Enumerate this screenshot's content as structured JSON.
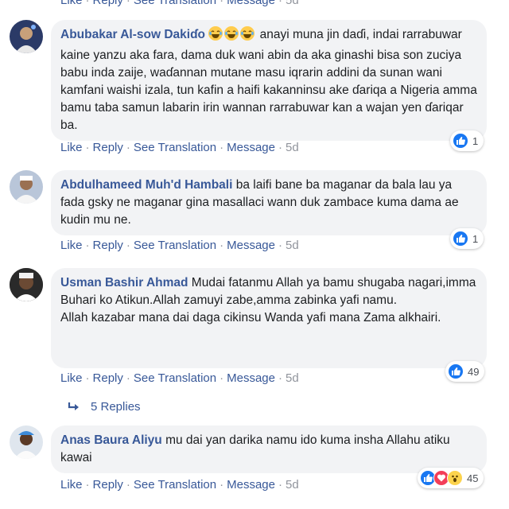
{
  "actions": {
    "like": "Like",
    "reply": "Reply",
    "see_translation": "See Translation",
    "message": "Message",
    "sep": "·"
  },
  "colors": {
    "link": "#385898",
    "bubble": "#f2f3f5",
    "like_blue": "#1877f2"
  },
  "top_partial": {
    "age": "5d"
  },
  "comments": [
    {
      "author": "Abubakar Al-sow Dakiɗo",
      "emoji": "😂😂😂",
      "text": " anayi muna jin daɗi, indai rarrabuwar kaine yanzu aka fara, dama duk wani abin da aka ginashi bisa son zuciya babu inda zaije, waɗannan mutane masu iqrarin addini da sunan wani kamfani waishi izala, tun kafin a haifi kakanninsu ake ɗariqa a Nigeria amma bamu taba samun labarin irin wannan rarrabuwar kan a wajan yen ɗariqar ba.",
      "age": "5d",
      "reactions": "1"
    },
    {
      "author": "Abdulhameed Muh'd Hambali",
      "text": " ba laifi bane ba maganar da bala lau ya fada gsky ne maganar gina masallaci wann duk zambace kuma dama ae kudin mu ne.",
      "age": "5d",
      "reactions": "1"
    },
    {
      "author": "Usman Bashir Ahmad",
      "text": " Mudai fatanmu Allah ya bamu shugaba nagari,imma Buhari ko Atikun.Allah zamuyi zabe,amma zabinka yafi namu.",
      "text2": "Allah kazabar mana dai daga cikinsu Wanda yafi mana Zama alkhairi.",
      "age": "5d",
      "reactions": "49",
      "replies": "5 Replies"
    },
    {
      "author": "Anas Baura Aliyu",
      "text": " mu dai yan darika namu ido kuma insha Allahu atiku kawai",
      "age": "5d",
      "reactions": "45"
    }
  ]
}
